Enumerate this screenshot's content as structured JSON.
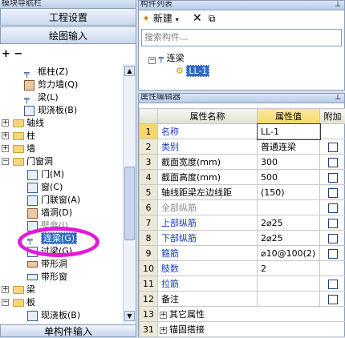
{
  "nav": {
    "title": "模块导航栏",
    "btn_project": "工程设置",
    "btn_draw": "绘图输入",
    "btn_single": "单构件输入",
    "tree": [
      {
        "label": "框柱(Z)",
        "icon": "column-icon"
      },
      {
        "label": "剪力墙(Q)",
        "icon": "shearwall-icon"
      },
      {
        "label": "梁(L)",
        "icon": "beam-icon"
      },
      {
        "label": "现浇板(B)",
        "icon": "slab-icon"
      },
      {
        "label": "轴线",
        "icon": "folder-icon"
      },
      {
        "label": "柱",
        "icon": "folder-icon"
      },
      {
        "label": "墙",
        "icon": "folder-icon"
      },
      {
        "label": "门窗洞",
        "icon": "folder-icon"
      },
      {
        "label": "门(M)",
        "icon": "door-icon"
      },
      {
        "label": "窗(C)",
        "icon": "window-icon"
      },
      {
        "label": "门联窗(A)",
        "icon": "doorwindow-icon"
      },
      {
        "label": "墙洞(D)",
        "icon": "wallhole-icon"
      },
      {
        "label": "壁龛(I)",
        "icon": "niche-icon"
      },
      {
        "label": "连梁(G)",
        "icon": "coupling-beam-icon"
      },
      {
        "label": "过梁(G)",
        "icon": "lintel-icon"
      },
      {
        "label": "带形洞",
        "icon": "strip-hole-icon"
      },
      {
        "label": "带形窗",
        "icon": "strip-window-icon"
      },
      {
        "label": "梁",
        "icon": "folder-icon"
      },
      {
        "label": "板",
        "icon": "folder-icon"
      },
      {
        "label": "现浇板(B)",
        "icon": "slab-icon"
      }
    ]
  },
  "component_list": {
    "title": "构件列表",
    "new_label": "新建",
    "search_placeholder": "搜索构件...",
    "tree_root": "连梁",
    "tree_item": "LL-1"
  },
  "props": {
    "title": "属性编辑器",
    "headers": [
      "属性名称",
      "属性值",
      "附加"
    ],
    "rows": [
      {
        "num": "1",
        "name": "名称",
        "value": "LL-1",
        "check": false,
        "style": "blue"
      },
      {
        "num": "2",
        "name": "类别",
        "value": "普通连梁",
        "check": true,
        "style": "blue"
      },
      {
        "num": "3",
        "name": "截面宽度(mm)",
        "value": "300",
        "check": true,
        "style": ""
      },
      {
        "num": "4",
        "name": "截面高度(mm)",
        "value": "500",
        "check": true,
        "style": ""
      },
      {
        "num": "5",
        "name": "轴线距梁左边线距",
        "value": "(150)",
        "check": true,
        "style": ""
      },
      {
        "num": "6",
        "name": "全部纵筋",
        "value": "",
        "check": true,
        "style": "gray"
      },
      {
        "num": "7",
        "name": "上部纵筋",
        "value": "2⌀25",
        "check": true,
        "style": "blue"
      },
      {
        "num": "8",
        "name": "下部纵筋",
        "value": "2⌀25",
        "check": true,
        "style": "blue"
      },
      {
        "num": "9",
        "name": "箍筋",
        "value": "⌀10@100(2)",
        "check": true,
        "style": "blue"
      },
      {
        "num": "10",
        "name": "肢数",
        "value": "2",
        "check": false,
        "style": "blue"
      },
      {
        "num": "11",
        "name": "拉筋",
        "value": "",
        "check": true,
        "style": "blue"
      },
      {
        "num": "12",
        "name": "备注",
        "value": "",
        "check": true,
        "style": ""
      },
      {
        "num": "13",
        "name": "其它属性",
        "value": "",
        "check": false,
        "style": "group"
      },
      {
        "num": "31",
        "name": "锚固搭接",
        "value": "",
        "check": false,
        "style": "group"
      }
    ]
  },
  "colors": {
    "accent": "#316ac5",
    "highlight_ring": "#e21bd6",
    "header_value_bg": "#f5d86b"
  }
}
